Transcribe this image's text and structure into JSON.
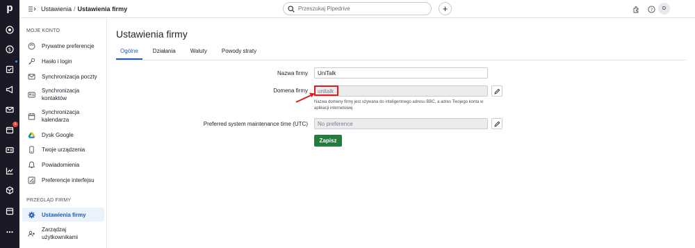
{
  "rail": {
    "logo": "p",
    "icons": [
      "target-icon",
      "dollar-icon",
      "checklist-icon",
      "megaphone-icon",
      "mail-icon",
      "calendar-icon",
      "contact-card-icon",
      "chart-icon",
      "box-icon",
      "store-icon",
      "more-icon"
    ],
    "badge": "5"
  },
  "topbar": {
    "breadcrumb_parent": "Ustawienia",
    "breadcrumb_sep": "/",
    "breadcrumb_current": "Ustawienia firmy",
    "search_placeholder": "Przeszukaj Pipedrive",
    "plus": "+",
    "avatar": "D"
  },
  "sidebar": {
    "section1": "MOJE KONTO",
    "items": [
      {
        "label": "Prywatne preferencje",
        "icon": "face-icon"
      },
      {
        "label": "Hasło i login",
        "icon": "key-icon"
      },
      {
        "label": "Synchronizacja poczty",
        "icon": "mail-icon"
      },
      {
        "label": "Synchronizacja kontaktów",
        "icon": "contact-card-icon"
      },
      {
        "label": "Synchronizacja kalendarza",
        "icon": "calendar-icon"
      },
      {
        "label": "Dysk Google",
        "icon": "google-drive-icon"
      },
      {
        "label": "Twoje urządzenia",
        "icon": "phone-icon"
      },
      {
        "label": "Powiadomienia",
        "icon": "bell-icon"
      },
      {
        "label": "Preferencje interfejsu",
        "icon": "interface-icon"
      }
    ],
    "section2": "PRZEGLĄD FIRMY",
    "company_items": [
      {
        "label": "Ustawienia firmy",
        "icon": "gear-icon"
      },
      {
        "label": "Zarządzaj użytkownikami",
        "icon": "users-icon"
      }
    ]
  },
  "main": {
    "title": "Ustawienia firmy",
    "tabs": [
      "Ogólne",
      "Działania",
      "Waluty",
      "Powody straty"
    ],
    "fields": {
      "company_name_label": "Nazwa firmy",
      "company_name_value": "UniTalk",
      "domain_label": "Domena firmy",
      "domain_value": "unitalk",
      "domain_help": "Nazwa domeny firmy jest używana do inteligentnego adresu BBC, a adres Twojego konta w aplikacji internetowej.",
      "maintenance_label": "Preferred system maintenance time (UTC)",
      "maintenance_value": "No preference"
    },
    "save_label": "Zapisz"
  },
  "colors": {
    "rail": "#1a1a26",
    "accent": "#1f5ab4",
    "save": "#257a3e",
    "highlight": "#e21b1b"
  }
}
